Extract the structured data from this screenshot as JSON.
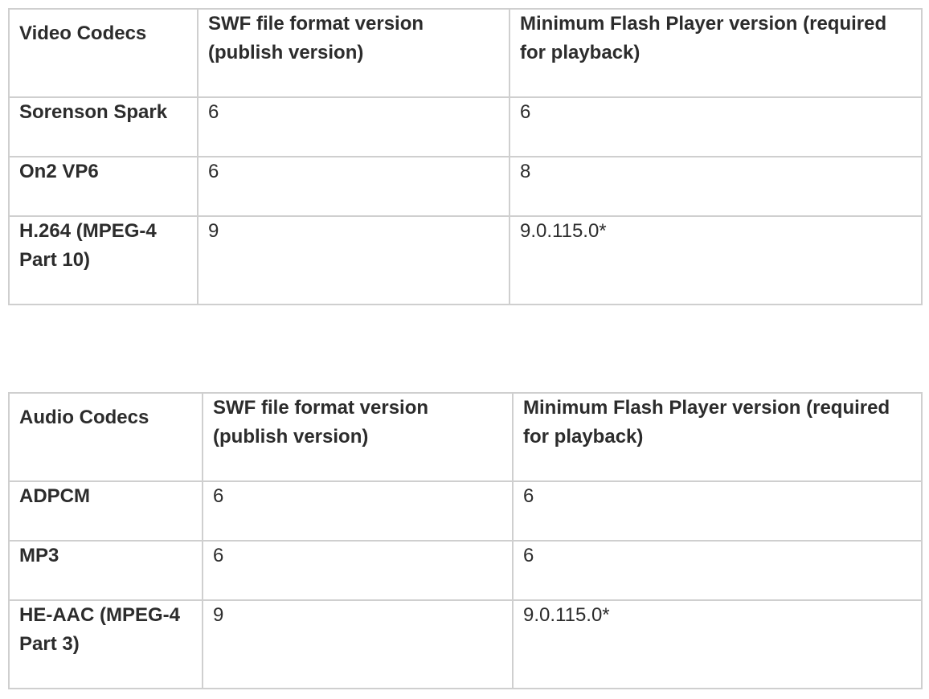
{
  "video": {
    "header": {
      "codec": "Video Codecs",
      "swf": "SWF file format version (publish version)",
      "player": "Minimum Flash Player version (required for playback)"
    },
    "rows": [
      {
        "codec": "Sorenson Spark",
        "swf": "6",
        "player": "6"
      },
      {
        "codec": "On2 VP6",
        "swf": "6",
        "player": "8"
      },
      {
        "codec": "H.264 (MPEG-4 Part 10)",
        "swf": "9",
        "player": "9.0.115.0*"
      }
    ]
  },
  "audio": {
    "header": {
      "codec": "Audio Codecs",
      "swf": "SWF file format version (publish version)",
      "player": "Minimum Flash Player version (required for playback)"
    },
    "rows": [
      {
        "codec": "ADPCM",
        "swf": "6",
        "player": "6"
      },
      {
        "codec": "MP3",
        "swf": "6",
        "player": "6"
      },
      {
        "codec": "HE-AAC (MPEG-4 Part 3)",
        "swf": "9",
        "player": "9.0.115.0*"
      }
    ]
  }
}
